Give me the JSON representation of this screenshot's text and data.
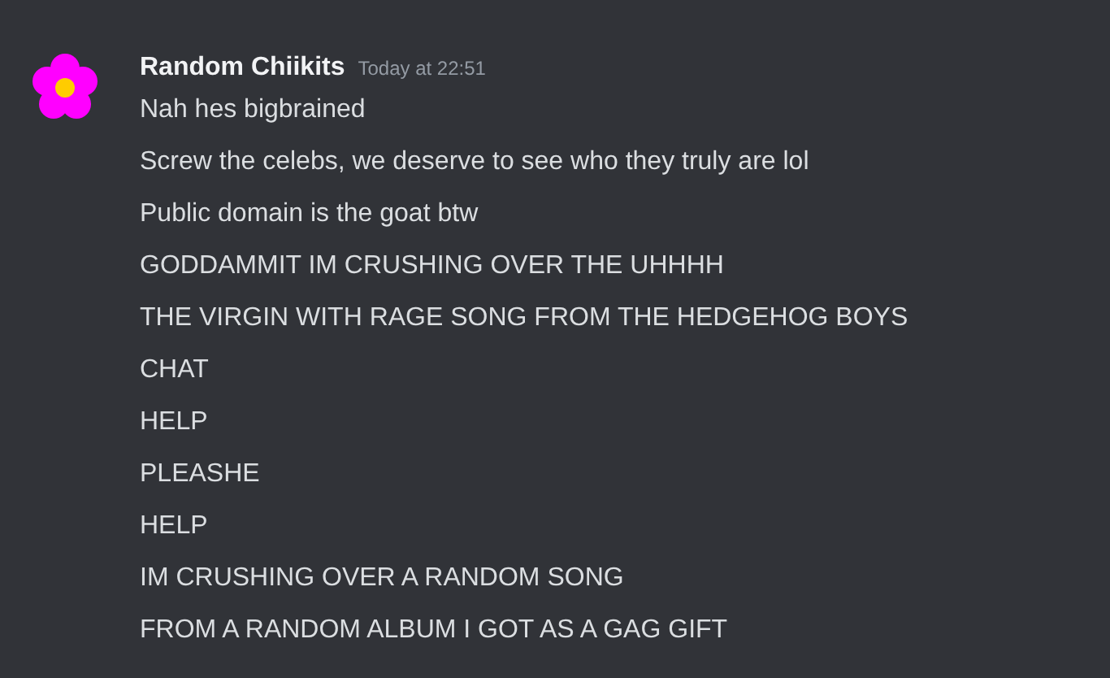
{
  "author": {
    "name": "Random Chiikits",
    "timestamp": "Today at 22:51"
  },
  "messages": [
    "Nah hes bigbrained",
    "Screw the celebs, we deserve to see who they truly are lol",
    "Public domain is the goat btw",
    "GODDAMMIT IM CRUSHING OVER THE UHHHH",
    "THE VIRGIN WITH RAGE SONG FROM THE HEDGEHOG BOYS",
    "CHAT",
    "HELP",
    "PLEASHE",
    "HELP",
    "IM CRUSHING OVER A RANDOM SONG",
    "FROM A RANDOM ALBUM I GOT AS A GAG GIFT"
  ]
}
